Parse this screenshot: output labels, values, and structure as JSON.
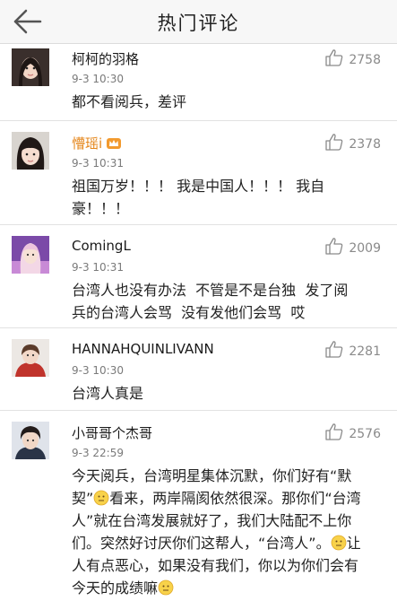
{
  "header": {
    "title": "热门评论",
    "back_icon": "back-arrow-icon"
  },
  "comments": [
    {
      "name": "柯柯的羽格",
      "time": "9-3 10:30",
      "likes": "2758",
      "text": "都不看阅兵，差评",
      "avatar": "avatar-dark-hair-girl"
    },
    {
      "name": "懵瑶i",
      "time": "9-3 10:31",
      "likes": "2378",
      "text": "祖国万岁！！！ 我是中国人！！！ 我自豪！！！",
      "avatar": "avatar-bangs-girl",
      "name_color": "#e5861a",
      "badge": "vip-crown-icon"
    },
    {
      "name": "ComingL",
      "time": "9-3 10:31",
      "likes": "2009",
      "text": "台湾人也没有办法  不管是不是台独  发了阅兵的台湾人会骂  没有发他们会骂  哎",
      "avatar": "avatar-pink-stage"
    },
    {
      "name": "HANNAHQUINLIVANN",
      "time": "9-3 10:30",
      "likes": "2281",
      "text": "台湾人真是",
      "avatar": "avatar-red-coat"
    },
    {
      "name": "小哥哥个杰哥",
      "time": "9-3 22:59",
      "likes": "2576",
      "text_parts": [
        "今天阅兵，台湾明星集体沉默，你们好有",
        "“默契”",
        "看来，两岸隔阂依然很深。那你",
        "们“台湾人”就在台湾发展就好了，我们大",
        "陆配不上你们。突然好讨厌你们这帮人，",
        "“台湾人”。",
        "让人有点恶心，如果没有我",
        "们，你以为你们会有今天的成绩嘛"
      ],
      "avatar": "avatar-boy"
    }
  ],
  "colors": {
    "accent_name": "#e5861a",
    "divider": "#e2e2e2",
    "meta_text": "#7a7a7a"
  }
}
